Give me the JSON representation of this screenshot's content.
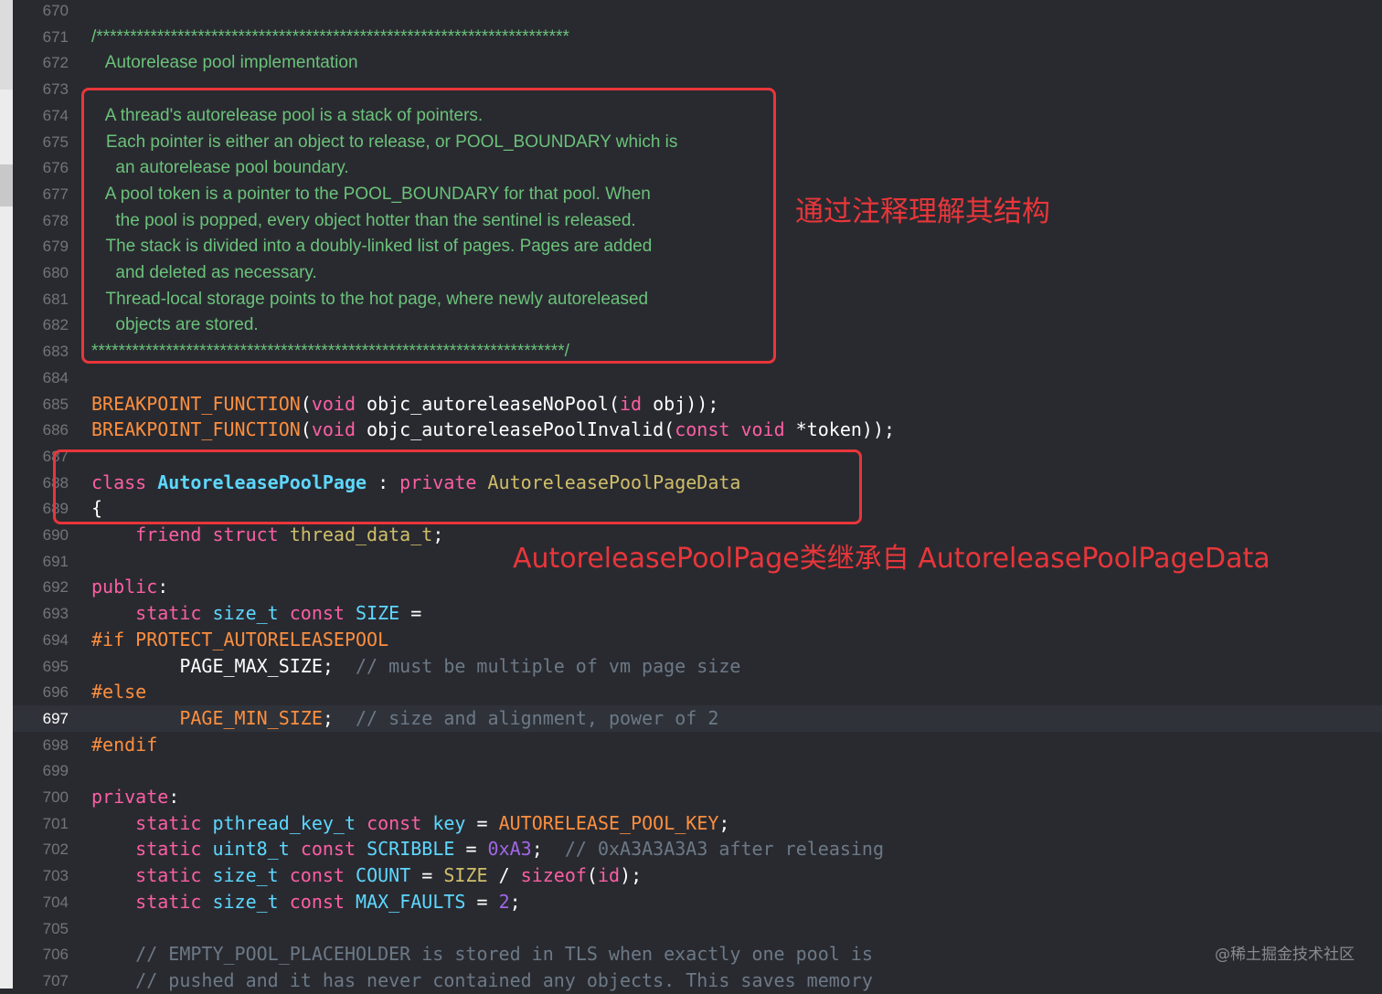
{
  "editor": {
    "current_line": "697",
    "lines": [
      {
        "n": "670",
        "t": "doc",
        "tokens": []
      },
      {
        "n": "671",
        "t": "doc",
        "tokens": [
          {
            "c": "docc",
            "s": "/**********************************************************************"
          }
        ]
      },
      {
        "n": "672",
        "t": "doc",
        "tokens": [
          {
            "c": "docc",
            "s": "   Autorelease pool implementation"
          }
        ]
      },
      {
        "n": "673",
        "t": "doc",
        "tokens": []
      },
      {
        "n": "674",
        "t": "doc",
        "tokens": [
          {
            "c": "docc",
            "s": "   A thread's autorelease pool is a stack of pointers."
          }
        ]
      },
      {
        "n": "675",
        "t": "doc",
        "tokens": [
          {
            "c": "docc",
            "s": "   Each pointer is either an object to release, or POOL_BOUNDARY which is"
          }
        ]
      },
      {
        "n": "676",
        "t": "doc",
        "tokens": [
          {
            "c": "docc",
            "s": "     an autorelease pool boundary."
          }
        ]
      },
      {
        "n": "677",
        "t": "doc",
        "tokens": [
          {
            "c": "docc",
            "s": "   A pool token is a pointer to the POOL_BOUNDARY for that pool. When"
          }
        ]
      },
      {
        "n": "678",
        "t": "doc",
        "tokens": [
          {
            "c": "docc",
            "s": "     the pool is popped, every object hotter than the sentinel is released."
          }
        ]
      },
      {
        "n": "679",
        "t": "doc",
        "tokens": [
          {
            "c": "docc",
            "s": "   The stack is divided into a doubly-linked list of pages. Pages are added"
          }
        ]
      },
      {
        "n": "680",
        "t": "doc",
        "tokens": [
          {
            "c": "docc",
            "s": "     and deleted as necessary."
          }
        ]
      },
      {
        "n": "681",
        "t": "doc",
        "tokens": [
          {
            "c": "docc",
            "s": "   Thread-local storage points to the hot page, where newly autoreleased"
          }
        ]
      },
      {
        "n": "682",
        "t": "doc",
        "tokens": [
          {
            "c": "docc",
            "s": "     objects are stored."
          }
        ]
      },
      {
        "n": "683",
        "t": "doc",
        "tokens": [
          {
            "c": "docc",
            "s": "**********************************************************************/"
          }
        ]
      },
      {
        "n": "684",
        "t": "code",
        "tokens": []
      },
      {
        "n": "685",
        "t": "code",
        "tokens": [
          {
            "c": "macro",
            "s": "BREAKPOINT_FUNCTION"
          },
          {
            "c": "plain",
            "s": "("
          },
          {
            "c": "kw",
            "s": "void"
          },
          {
            "c": "plain",
            "s": " objc_autoreleaseNoPool("
          },
          {
            "c": "kw",
            "s": "id"
          },
          {
            "c": "plain",
            "s": " obj));"
          }
        ]
      },
      {
        "n": "686",
        "t": "code",
        "tokens": [
          {
            "c": "macro",
            "s": "BREAKPOINT_FUNCTION"
          },
          {
            "c": "plain",
            "s": "("
          },
          {
            "c": "kw",
            "s": "void"
          },
          {
            "c": "plain",
            "s": " objc_autoreleasePoolInvalid("
          },
          {
            "c": "kw",
            "s": "const"
          },
          {
            "c": "plain",
            "s": " "
          },
          {
            "c": "kw",
            "s": "void"
          },
          {
            "c": "plain",
            "s": " *token));"
          }
        ]
      },
      {
        "n": "687",
        "t": "code",
        "tokens": []
      },
      {
        "n": "688",
        "t": "code",
        "tokens": [
          {
            "c": "kw",
            "s": "class"
          },
          {
            "c": "plain",
            "s": " "
          },
          {
            "c": "cls",
            "s": "AutoreleasePoolPage"
          },
          {
            "c": "plain",
            "s": " : "
          },
          {
            "c": "kw",
            "s": "private"
          },
          {
            "c": "plain",
            "s": " "
          },
          {
            "c": "type2",
            "s": "AutoreleasePoolPageData"
          }
        ]
      },
      {
        "n": "689",
        "t": "code",
        "tokens": [
          {
            "c": "plain",
            "s": "{"
          }
        ]
      },
      {
        "n": "690",
        "t": "code",
        "tokens": [
          {
            "c": "plain",
            "s": "    "
          },
          {
            "c": "kw",
            "s": "friend"
          },
          {
            "c": "plain",
            "s": " "
          },
          {
            "c": "kw",
            "s": "struct"
          },
          {
            "c": "plain",
            "s": " "
          },
          {
            "c": "type2",
            "s": "thread_data_t"
          },
          {
            "c": "plain",
            "s": ";"
          }
        ]
      },
      {
        "n": "691",
        "t": "code",
        "tokens": []
      },
      {
        "n": "692",
        "t": "code",
        "tokens": [
          {
            "c": "kw",
            "s": "public"
          },
          {
            "c": "plain",
            "s": ":"
          }
        ]
      },
      {
        "n": "693",
        "t": "code",
        "tokens": [
          {
            "c": "plain",
            "s": "    "
          },
          {
            "c": "kw",
            "s": "static"
          },
          {
            "c": "plain",
            "s": " "
          },
          {
            "c": "type",
            "s": "size_t"
          },
          {
            "c": "plain",
            "s": " "
          },
          {
            "c": "kw",
            "s": "const"
          },
          {
            "c": "plain",
            "s": " "
          },
          {
            "c": "type",
            "s": "SIZE"
          },
          {
            "c": "plain",
            "s": " ="
          }
        ]
      },
      {
        "n": "694",
        "t": "code",
        "tokens": [
          {
            "c": "pp",
            "s": "#if PROTECT_AUTORELEASEPOOL"
          }
        ]
      },
      {
        "n": "695",
        "t": "code",
        "tokens": [
          {
            "c": "plain",
            "s": "        PAGE_MAX_SIZE;  "
          },
          {
            "c": "cmt",
            "s": "// must be multiple of vm page size"
          }
        ]
      },
      {
        "n": "696",
        "t": "code",
        "tokens": [
          {
            "c": "pp",
            "s": "#else"
          }
        ]
      },
      {
        "n": "697",
        "t": "code",
        "tokens": [
          {
            "c": "plain",
            "s": "        "
          },
          {
            "c": "macro",
            "s": "PAGE_MIN_SIZE"
          },
          {
            "c": "plain",
            "s": ";  "
          },
          {
            "c": "cmt",
            "s": "// size and alignment, power of 2"
          }
        ]
      },
      {
        "n": "698",
        "t": "code",
        "tokens": [
          {
            "c": "pp",
            "s": "#endif"
          }
        ]
      },
      {
        "n": "699",
        "t": "code",
        "tokens": []
      },
      {
        "n": "700",
        "t": "code",
        "tokens": [
          {
            "c": "kw",
            "s": "private"
          },
          {
            "c": "plain",
            "s": ":"
          }
        ]
      },
      {
        "n": "701",
        "t": "code",
        "tokens": [
          {
            "c": "plain",
            "s": "    "
          },
          {
            "c": "kw",
            "s": "static"
          },
          {
            "c": "plain",
            "s": " "
          },
          {
            "c": "type",
            "s": "pthread_key_t"
          },
          {
            "c": "plain",
            "s": " "
          },
          {
            "c": "kw",
            "s": "const"
          },
          {
            "c": "plain",
            "s": " "
          },
          {
            "c": "type",
            "s": "key"
          },
          {
            "c": "plain",
            "s": " = "
          },
          {
            "c": "macro",
            "s": "AUTORELEASE_POOL_KEY"
          },
          {
            "c": "plain",
            "s": ";"
          }
        ]
      },
      {
        "n": "702",
        "t": "code",
        "tokens": [
          {
            "c": "plain",
            "s": "    "
          },
          {
            "c": "kw",
            "s": "static"
          },
          {
            "c": "plain",
            "s": " "
          },
          {
            "c": "type",
            "s": "uint8_t"
          },
          {
            "c": "plain",
            "s": " "
          },
          {
            "c": "kw",
            "s": "const"
          },
          {
            "c": "plain",
            "s": " "
          },
          {
            "c": "type",
            "s": "SCRIBBLE"
          },
          {
            "c": "plain",
            "s": " = "
          },
          {
            "c": "other",
            "s": "0xA3"
          },
          {
            "c": "plain",
            "s": ";  "
          },
          {
            "c": "cmt",
            "s": "// 0xA3A3A3A3 after releasing"
          }
        ]
      },
      {
        "n": "703",
        "t": "code",
        "tokens": [
          {
            "c": "plain",
            "s": "    "
          },
          {
            "c": "kw",
            "s": "static"
          },
          {
            "c": "plain",
            "s": " "
          },
          {
            "c": "type",
            "s": "size_t"
          },
          {
            "c": "plain",
            "s": " "
          },
          {
            "c": "kw",
            "s": "const"
          },
          {
            "c": "plain",
            "s": " "
          },
          {
            "c": "type",
            "s": "COUNT"
          },
          {
            "c": "plain",
            "s": " = "
          },
          {
            "c": "type2",
            "s": "SIZE"
          },
          {
            "c": "plain",
            "s": " / "
          },
          {
            "c": "kw",
            "s": "sizeof"
          },
          {
            "c": "plain",
            "s": "("
          },
          {
            "c": "kw",
            "s": "id"
          },
          {
            "c": "plain",
            "s": ");"
          }
        ]
      },
      {
        "n": "704",
        "t": "code",
        "tokens": [
          {
            "c": "plain",
            "s": "    "
          },
          {
            "c": "kw",
            "s": "static"
          },
          {
            "c": "plain",
            "s": " "
          },
          {
            "c": "type",
            "s": "size_t"
          },
          {
            "c": "plain",
            "s": " "
          },
          {
            "c": "kw",
            "s": "const"
          },
          {
            "c": "plain",
            "s": " "
          },
          {
            "c": "type",
            "s": "MAX_FAULTS"
          },
          {
            "c": "plain",
            "s": " = "
          },
          {
            "c": "other",
            "s": "2"
          },
          {
            "c": "plain",
            "s": ";"
          }
        ]
      },
      {
        "n": "705",
        "t": "code",
        "tokens": []
      },
      {
        "n": "706",
        "t": "code",
        "tokens": [
          {
            "c": "plain",
            "s": "    "
          },
          {
            "c": "cmt",
            "s": "// EMPTY_POOL_PLACEHOLDER is stored in TLS when exactly one pool is"
          }
        ]
      },
      {
        "n": "707",
        "t": "code",
        "tokens": [
          {
            "c": "plain",
            "s": "    "
          },
          {
            "c": "cmt",
            "s": "// pushed and it has never contained any objects. This saves memory"
          }
        ]
      }
    ]
  },
  "annotations": {
    "comment_note": "通过注释理解其结构",
    "inherit_note": "AutoreleasePoolPage类继承自 AutoreleasePoolPageData"
  },
  "watermark": "@稀土掘金技术社区",
  "colors": {
    "background": "#292a30",
    "keyword": "#fc5fa3",
    "comment": "#6c7986",
    "doc_comment": "#6bc27a",
    "annotation_red": "#e8363a"
  }
}
